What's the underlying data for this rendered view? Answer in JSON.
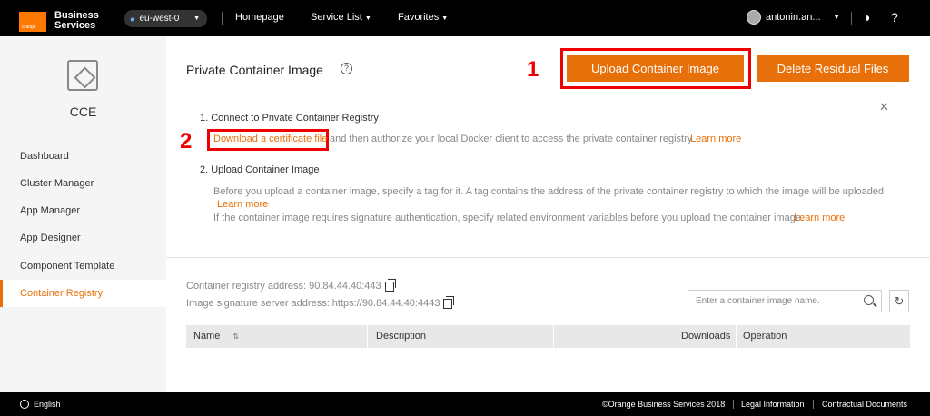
{
  "topbar": {
    "logo_small": "orange",
    "brand_line1": "Business",
    "brand_line2": "Services",
    "region": "eu-west-0",
    "nav": [
      "Homepage",
      "Service List",
      "Favorites"
    ],
    "user": "antonin.an...",
    "theme_icon": "contrast-icon",
    "help_icon": "question-icon"
  },
  "sidebar": {
    "title": "CCE",
    "items": [
      {
        "label": "Dashboard"
      },
      {
        "label": "Cluster Manager"
      },
      {
        "label": "App Manager"
      },
      {
        "label": "App Designer"
      },
      {
        "label": "Component Template"
      },
      {
        "label": "Container Registry"
      }
    ]
  },
  "main": {
    "title": "Private Container Image",
    "upload_button": "Upload Container Image",
    "delete_button": "Delete Residual Files",
    "annotation_1": "1",
    "annotation_2": "2",
    "step1_title": "1. Connect to Private Container Registry",
    "step1_link": "Download a certificate file",
    "step1_text": "and then authorize your local Docker client to access the private container registry.",
    "learn_more": "Learn more",
    "step2_title": "2. Upload Container Image",
    "step2_text1": "Before you upload a container image, specify a tag for it. A tag contains the address of the private container registry to which the image will be uploaded.",
    "step2_text2": "If the container image requires signature authentication, specify related environment variables before you upload the container image.",
    "registry_address": "Container registry address: 90.84.44.40:443",
    "signature_address": "Image signature server address: https://90.84.44.40:4443",
    "search_placeholder": "Enter a container image name.",
    "columns": [
      "Name",
      "Description",
      "Downloads",
      "Operation"
    ]
  },
  "footer": {
    "language": "English",
    "copyright": "©Orange Business Services 2018",
    "legal": "Legal Information",
    "contractual": "Contractual Documents"
  },
  "colors": {
    "accent": "#e8700a",
    "brand": "#ff7900",
    "annotation": "#e00000"
  }
}
